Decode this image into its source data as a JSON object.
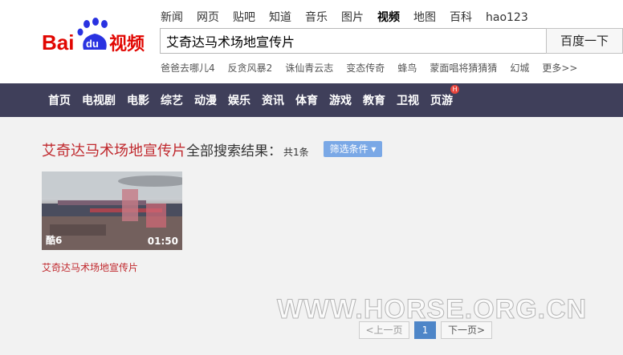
{
  "logo": {
    "text_bai": "Bai",
    "text_du": "du",
    "text_product": "视频"
  },
  "top_nav": [
    "新闻",
    "网页",
    "贴吧",
    "知道",
    "音乐",
    "图片",
    "视频",
    "地图",
    "百科",
    "hao123"
  ],
  "active_nav": "视频",
  "search": {
    "value": "艾奇达马术场地宣传片",
    "button": "百度一下"
  },
  "hot_words": [
    "爸爸去哪儿4",
    "反贪风暴2",
    "诛仙青云志",
    "变态传奇",
    "蜂鸟",
    "蒙面唱将猜猜猜",
    "幻城",
    "更多>>"
  ],
  "channels": [
    "首页",
    "电视剧",
    "电影",
    "综艺",
    "动漫",
    "娱乐",
    "资讯",
    "体育",
    "游戏",
    "教育",
    "卫视",
    "页游"
  ],
  "channel_badge": "H",
  "results": {
    "query": "艾奇达马术场地宣传片",
    "label": "全部搜索结果：",
    "count": "共1条",
    "filter": "筛选条件"
  },
  "videos": [
    {
      "title": "艾奇达马术场地宣传片",
      "source": "酷6",
      "duration": "01:50"
    }
  ],
  "pager": {
    "prev": "<上一页",
    "current": "1",
    "next": "下一页>"
  },
  "watermark": "WWW.HORSE.ORG.CN",
  "colors": {
    "brand_red": "#e10601",
    "brand_blue": "#2932e1",
    "nav_bg": "#3f3f5a",
    "query_red": "#c0282d"
  }
}
